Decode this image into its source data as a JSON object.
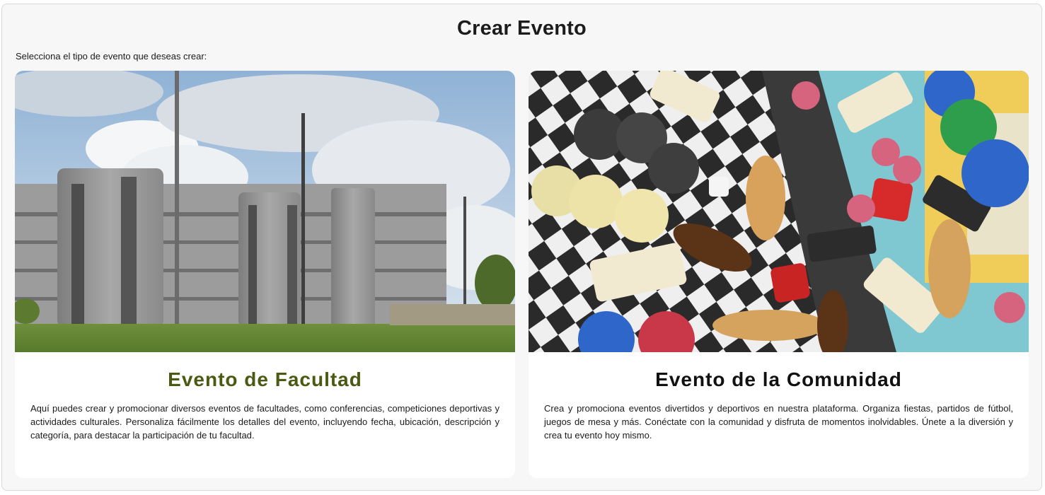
{
  "page": {
    "title": "Crear Evento",
    "subtitle": "Selecciona el tipo de evento que deseas crear:"
  },
  "cards": [
    {
      "title": "Evento de Facultad",
      "title_color": "#4a5a12",
      "description": "Aquí puedes crear y promocionar diversos eventos de facultades, como conferencias, competiciones deportivas y actividades culturales. Personaliza fácilmente los detalles del evento, incluyendo fecha, ubicación, descripción y categoría, para destacar la participación de tu facultad.",
      "image": "faculty-building-photo"
    },
    {
      "title": "Evento de la Comunidad",
      "title_color": "#111111",
      "description": "Crea y promociona eventos divertidos y deportivos en nuestra plataforma. Organiza fiestas, partidos de fútbol, juegos de mesa y más. Conéctate con la comunidad y disfruta de momentos inolvidables. Únete a la diversión y crea tu evento hoy mismo.",
      "image": "board-games-photo"
    }
  ]
}
